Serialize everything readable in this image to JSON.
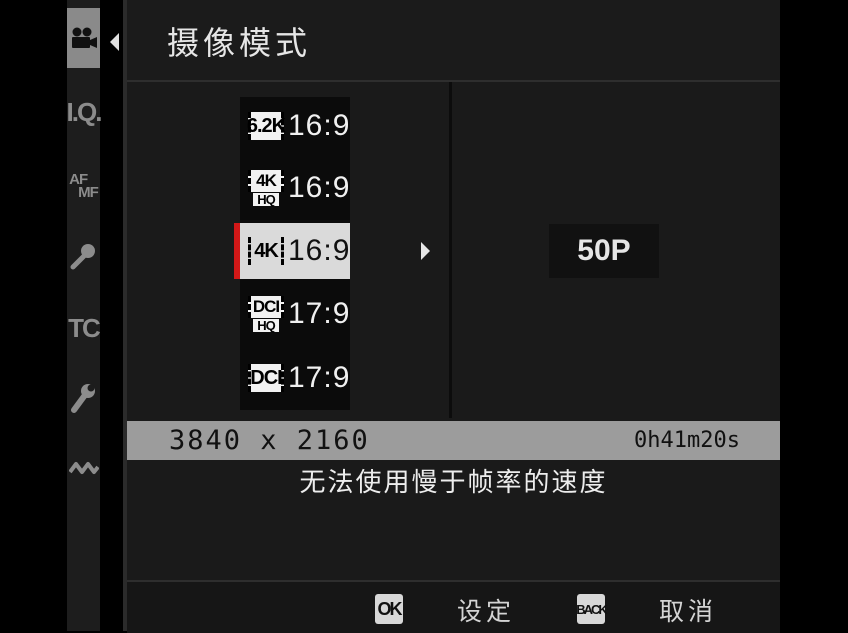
{
  "header": {
    "title": "摄像模式"
  },
  "rail": {
    "items": [
      {
        "id": "movie",
        "label": "",
        "icon": "movie-camera-icon",
        "active": true
      },
      {
        "id": "iq",
        "label": "I.Q."
      },
      {
        "id": "afmf",
        "label_top": "AF",
        "label_bottom": "MF"
      },
      {
        "id": "audio",
        "label": "",
        "icon": "microphone-icon"
      },
      {
        "id": "tc",
        "label": "TC"
      },
      {
        "id": "setup",
        "label": "",
        "icon": "wrench-icon"
      },
      {
        "id": "connection",
        "label": "",
        "icon": "connection-icon"
      }
    ]
  },
  "modes": [
    {
      "badge": "6.2K",
      "hq": "",
      "ratio": "16:9"
    },
    {
      "badge": "4K",
      "hq": "HQ",
      "ratio": "16:9"
    },
    {
      "badge": "4K",
      "hq": "",
      "ratio": "16:9",
      "selected": true
    },
    {
      "badge": "DCI",
      "hq": "HQ",
      "ratio": "17:9"
    },
    {
      "badge": "DCI",
      "hq": "",
      "ratio": "17:9"
    }
  ],
  "frame_rate": {
    "value": "50P"
  },
  "info": {
    "resolution": "3840 x 2160",
    "record_time": "0h41m20s"
  },
  "warning": "无法使用慢于帧率的速度",
  "footer": {
    "ok_key": "OK",
    "ok_label": "设定",
    "back_key": "BACK",
    "back_label": "取消"
  },
  "colors": {
    "selection_marker": "#d21818",
    "info_bar": "#9c9c9c"
  }
}
